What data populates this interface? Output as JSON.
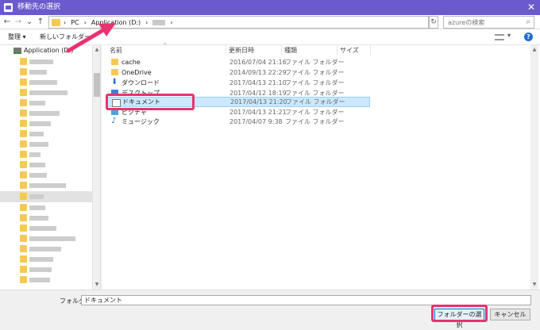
{
  "window": {
    "title": "移動先の選択",
    "close": "✕"
  },
  "address": {
    "back": "←",
    "forward": "→",
    "history": "⌄",
    "up": "↑",
    "crumbs": [
      "PC",
      "Application (D:)"
    ],
    "refresh": "↻",
    "search_placeholder": "azureの検索",
    "search_icon": "search-icon"
  },
  "toolbar": {
    "organize": "整理 ▾",
    "new_folder": "新しいフォルダー",
    "help": "?"
  },
  "nav": {
    "drive": "Application (D:)"
  },
  "columns": {
    "name": "名前",
    "date": "更新日時",
    "type": "種類",
    "size": "サイズ"
  },
  "files": [
    {
      "name": "cache",
      "date": "2016/07/04 21:16",
      "type": "ファイル フォルダー",
      "icon": "folder-icon"
    },
    {
      "name": "OneDrive",
      "date": "2014/09/13 22:29",
      "type": "ファイル フォルダー",
      "icon": "folder-icon"
    },
    {
      "name": "ダウンロード",
      "date": "2017/04/13 21:10",
      "type": "ファイル フォルダー",
      "icon": "download-icon"
    },
    {
      "name": "デスクトップ",
      "date": "2017/04/12 18:19",
      "type": "ファイル フォルダー",
      "icon": "desktop-icon"
    },
    {
      "name": "ドキュメント",
      "date": "2017/04/13 21:20",
      "type": "ファイル フォルダー",
      "icon": "document-icon"
    },
    {
      "name": "ピクチャ",
      "date": "2017/04/13 21:21",
      "type": "ファイル フォルダー",
      "icon": "picture-icon"
    },
    {
      "name": "ミュージック",
      "date": "2017/04/07 9:38",
      "type": "ファイル フォルダー",
      "icon": "music-icon"
    }
  ],
  "bottom": {
    "folder_label": "フォルダー:",
    "folder_value": "ドキュメント",
    "select_button": "フォルダーの選択",
    "cancel_button": "キャンセル"
  },
  "colors": {
    "titlebar": "#6a5acd",
    "highlight": "#e8336f",
    "selection": "#cce8ff"
  }
}
